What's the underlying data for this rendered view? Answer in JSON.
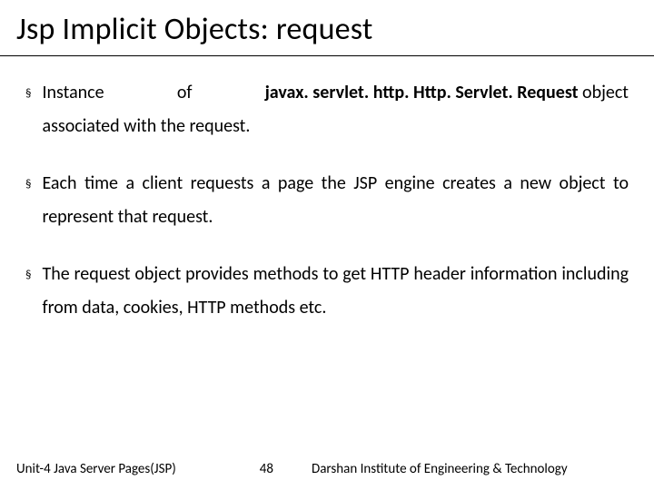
{
  "title": "Jsp Implicit Objects: request",
  "bullets": [
    {
      "line1_parts": [
        "Instance",
        "of",
        ""
      ],
      "class_name": "javax. servlet. http. Http. Servlet. Request",
      "class_suffix": " object",
      "line2": "associated with the request."
    },
    {
      "text": "Each time a client requests a page the JSP engine creates a new object to represent that request."
    },
    {
      "text": "The request object provides methods to get HTTP header information including from data, cookies, HTTP methods etc."
    }
  ],
  "footer": {
    "left": "Unit-4 Java Server Pages(JSP)",
    "page": "48",
    "right": "Darshan Institute of Engineering & Technology"
  },
  "marker": "§"
}
